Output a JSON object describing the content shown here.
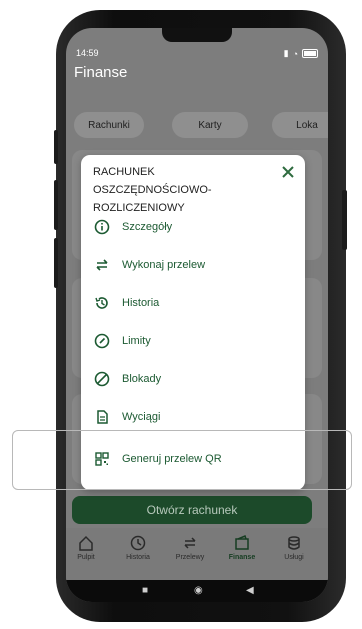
{
  "status_bar": {
    "time": "14:59",
    "battery": "100"
  },
  "app": {
    "title": "Finanse"
  },
  "tabs": [
    "Rachunki",
    "Karty",
    "Loka"
  ],
  "modal": {
    "title": "RACHUNEK OSZCZĘDNOŚCIOWO-ROZLICZENIOWY",
    "items": [
      {
        "label": "Szczegóły",
        "icon": "info-icon"
      },
      {
        "label": "Wykonaj przelew",
        "icon": "transfer-icon"
      },
      {
        "label": "Historia",
        "icon": "history-icon"
      },
      {
        "label": "Limity",
        "icon": "gauge-icon"
      },
      {
        "label": "Blokady",
        "icon": "block-icon"
      },
      {
        "label": "Wyciągi",
        "icon": "document-icon"
      },
      {
        "label": "Generuj przelew QR",
        "icon": "qr-icon"
      }
    ]
  },
  "open_account_label": "Otwórz rachunek",
  "bottom_nav": [
    {
      "label": "Pulpit",
      "icon": "home-icon",
      "active": false
    },
    {
      "label": "Historia",
      "icon": "history-icon",
      "active": false
    },
    {
      "label": "Przelewy",
      "icon": "transfer-icon",
      "active": false
    },
    {
      "label": "Finanse",
      "icon": "wallet-icon",
      "active": true
    },
    {
      "label": "Usługi",
      "icon": "database-icon",
      "active": false
    }
  ],
  "colors": {
    "brand_green": "#1c5a32",
    "dark_green": "#1c4a2a"
  }
}
